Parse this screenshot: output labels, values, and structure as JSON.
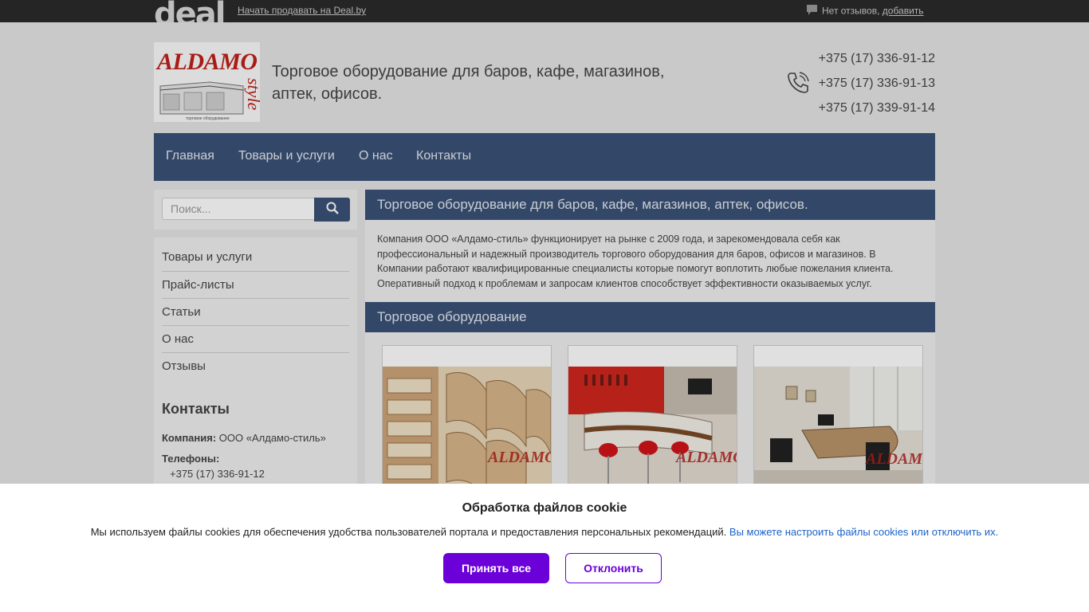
{
  "topbar": {
    "logo_text": "deal",
    "sell_link": "Начать продавать на Deal.by",
    "reviews_text": "Нет отзывов,",
    "reviews_add": "добавить"
  },
  "header": {
    "logo_text": "ALDAMO",
    "logo_sub": "style",
    "logo_caption": "торговое оборудование",
    "tagline": "Торговое оборудование для баров, кафе, магазинов, аптек, офисов.",
    "phones": [
      "+375 (17) 336-91-12",
      "+375 (17) 336-91-13",
      "+375 (17) 339-91-14"
    ]
  },
  "nav": [
    "Главная",
    "Товары и услуги",
    "О нас",
    "Контакты"
  ],
  "search": {
    "placeholder": "Поиск..."
  },
  "sidebar": {
    "items": [
      "Товары и услуги",
      "Прайс-листы",
      "Статьи",
      "О нас",
      "Отзывы"
    ],
    "contacts_title": "Контакты",
    "company_label": "Компания:",
    "company_value": "ООО «Алдамо-стиль»",
    "phones_label": "Телефоны:",
    "phone_first": "+375 (17) 336-91-12"
  },
  "main": {
    "title": "Торговое оборудование для баров, кафе, магазинов, аптек, офисов.",
    "description": "Компания ООО «Алдамо-стиль» функционирует на рынке с 2009 года, и зарекомендовала себя как профессиональный и надежный производитель торгового оборудования для баров, офисов и магазинов. В Компании работают квалифицированные специалисты которые помогут воплотить любые пожелания клиента. Оперативный подход к проблемам и запросам клиентов способствует эффективности оказываемых услуг.",
    "section_title": "Торговое оборудование",
    "watermark": "ALDAMO"
  },
  "cookie": {
    "title": "Обработка файлов cookie",
    "text": "Мы используем файлы cookies для обеспечения удобства пользователей портала и предоставления персональных рекомендаций.",
    "link": "Вы можете настроить файлы cookies или отключить их.",
    "accept": "Принять все",
    "decline": "Отклонить"
  },
  "colors": {
    "nav_bg": "#3b5378",
    "accent": "#6b00d8",
    "link": "#1c63c8"
  }
}
